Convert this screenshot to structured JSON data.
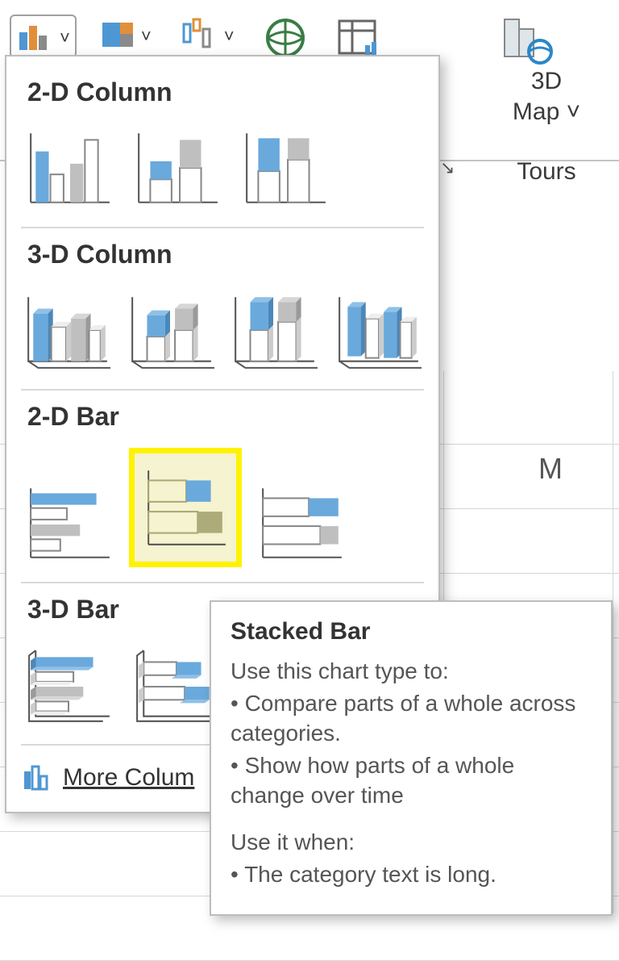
{
  "ribbon": {
    "map_label": "3D",
    "map_sub": "Map ˅",
    "section": "Tours"
  },
  "panel": {
    "sections": {
      "s0": "2-D Column",
      "s1": "3-D Column",
      "s2": "2-D Bar",
      "s3": "3-D Bar"
    },
    "more_label": "More Colum"
  },
  "tooltip": {
    "title": "Stacked Bar",
    "l1": "Use this chart type to:",
    "l2": "• Compare parts of a whole across categories.",
    "l3": "• Show how parts of a whole change over time",
    "l4": "Use it when:",
    "l5": "• The category text is long."
  },
  "sheet": {
    "col": "M"
  }
}
